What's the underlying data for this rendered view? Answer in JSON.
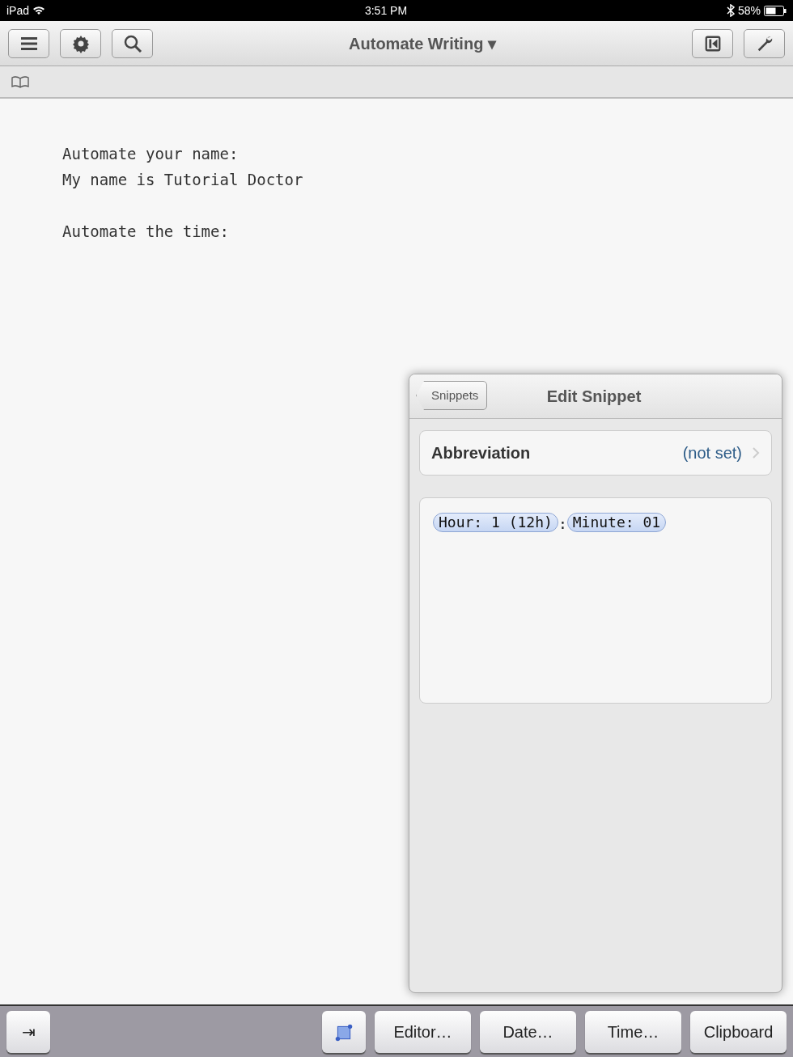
{
  "status_bar": {
    "carrier": "iPad",
    "time": "3:51 PM",
    "battery": "58%"
  },
  "toolbar": {
    "title": "Automate Writing",
    "title_caret": "▾",
    "left_buttons": [
      {
        "kind": "menu"
      },
      {
        "kind": "gear"
      },
      {
        "kind": "search"
      }
    ],
    "right_buttons": [
      {
        "kind": "skip-back"
      },
      {
        "kind": "wrench"
      }
    ]
  },
  "editor": {
    "paragraphs": [
      {
        "lines": [
          "Automate your name:",
          "My name is Tutorial Doctor"
        ]
      },
      {
        "lines": [
          "Automate the time:"
        ]
      }
    ]
  },
  "popover": {
    "back_button": "Snippets",
    "title": "Edit Snippet",
    "abbreviation": {
      "label": "Abbreviation",
      "value": "(not set)"
    },
    "content": [
      {
        "kind": "token",
        "text": "Hour: 1 (12h)"
      },
      {
        "kind": "text",
        "text": ":"
      },
      {
        "kind": "token",
        "text": "Minute: 01"
      }
    ]
  },
  "bottom_bar": {
    "tab_key": "⇥",
    "buttons": [
      {
        "kind": "selection"
      },
      {
        "kind": "text",
        "label": "Editor…"
      },
      {
        "kind": "text",
        "label": "Date…"
      },
      {
        "kind": "text",
        "label": "Time…"
      },
      {
        "kind": "text",
        "label": "Clipboard"
      }
    ]
  }
}
